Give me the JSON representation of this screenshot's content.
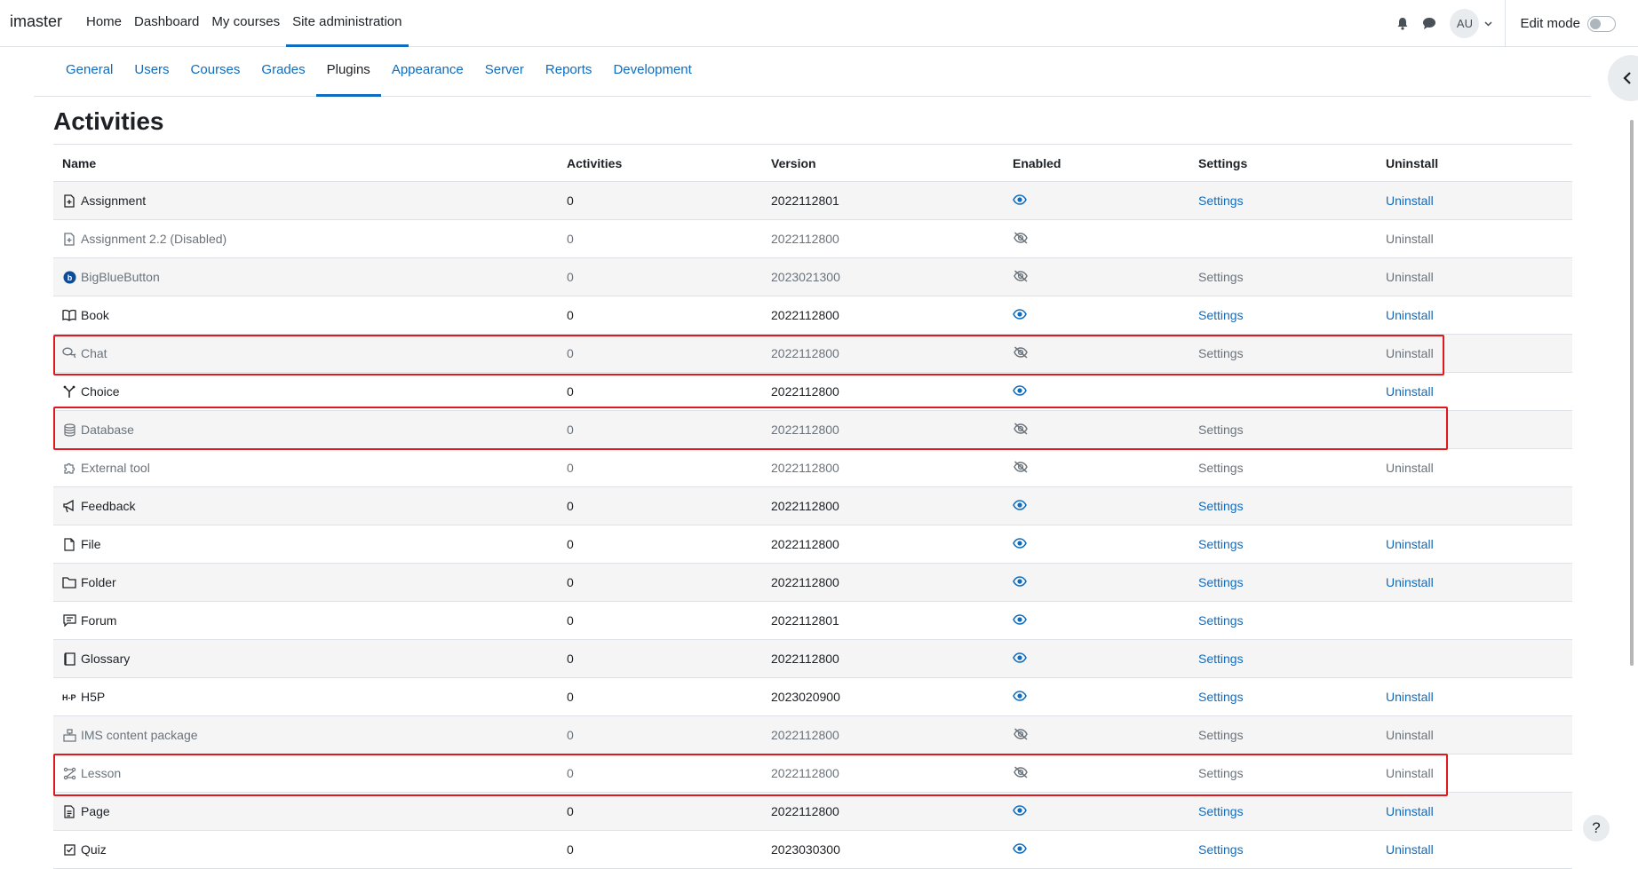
{
  "brand": "imaster",
  "primary_nav": [
    {
      "label": "Home"
    },
    {
      "label": "Dashboard"
    },
    {
      "label": "My courses"
    },
    {
      "label": "Site administration",
      "active": true
    }
  ],
  "user": {
    "initials": "AU"
  },
  "edit_mode_label": "Edit mode",
  "secondary_tabs": [
    "General",
    "Users",
    "Courses",
    "Grades",
    "Plugins",
    "Appearance",
    "Server",
    "Reports",
    "Development"
  ],
  "active_tab": "Plugins",
  "page_title": "Activities",
  "columns": {
    "name": "Name",
    "activities": "Activities",
    "version": "Version",
    "enabled": "Enabled",
    "settings": "Settings",
    "uninstall": "Uninstall"
  },
  "rows": [
    {
      "name": "Assignment",
      "icon": "assignment-icon",
      "activities": "0",
      "version": "2022112801",
      "enabled": true,
      "settings": "Settings",
      "uninstall": "Uninstall"
    },
    {
      "name": "Assignment 2.2 (Disabled)",
      "icon": "assignment-icon",
      "activities": "0",
      "version": "2022112800",
      "enabled": false,
      "settings": "",
      "uninstall": "Uninstall"
    },
    {
      "name": "BigBlueButton",
      "icon": "bigbluebutton-icon",
      "activities": "0",
      "version": "2023021300",
      "enabled": false,
      "settings": "Settings",
      "uninstall": "Uninstall"
    },
    {
      "name": "Book",
      "icon": "book-icon",
      "activities": "0",
      "version": "2022112800",
      "enabled": true,
      "settings": "Settings",
      "uninstall": "Uninstall"
    },
    {
      "name": "Chat",
      "icon": "chat-icon",
      "activities": "0",
      "version": "2022112800",
      "enabled": false,
      "settings": "Settings",
      "uninstall": "Uninstall",
      "highlighted": true
    },
    {
      "name": "Choice",
      "icon": "choice-icon",
      "activities": "0",
      "version": "2022112800",
      "enabled": true,
      "settings": "",
      "uninstall": "Uninstall"
    },
    {
      "name": "Database",
      "icon": "database-icon",
      "activities": "0",
      "version": "2022112800",
      "enabled": false,
      "settings": "Settings",
      "uninstall": "",
      "highlighted": true
    },
    {
      "name": "External tool",
      "icon": "puzzle-icon",
      "activities": "0",
      "version": "2022112800",
      "enabled": false,
      "settings": "Settings",
      "uninstall": "Uninstall"
    },
    {
      "name": "Feedback",
      "icon": "megaphone-icon",
      "activities": "0",
      "version": "2022112800",
      "enabled": true,
      "settings": "Settings",
      "uninstall": ""
    },
    {
      "name": "File",
      "icon": "file-icon",
      "activities": "0",
      "version": "2022112800",
      "enabled": true,
      "settings": "Settings",
      "uninstall": "Uninstall"
    },
    {
      "name": "Folder",
      "icon": "folder-icon",
      "activities": "0",
      "version": "2022112800",
      "enabled": true,
      "settings": "Settings",
      "uninstall": "Uninstall"
    },
    {
      "name": "Forum",
      "icon": "forum-icon",
      "activities": "0",
      "version": "2022112801",
      "enabled": true,
      "settings": "Settings",
      "uninstall": ""
    },
    {
      "name": "Glossary",
      "icon": "glossary-icon",
      "activities": "0",
      "version": "2022112800",
      "enabled": true,
      "settings": "Settings",
      "uninstall": ""
    },
    {
      "name": "H5P",
      "icon": "h5p-icon",
      "activities": "0",
      "version": "2023020900",
      "enabled": true,
      "settings": "Settings",
      "uninstall": "Uninstall"
    },
    {
      "name": "IMS content package",
      "icon": "package-icon",
      "activities": "0",
      "version": "2022112800",
      "enabled": false,
      "settings": "Settings",
      "uninstall": "Uninstall"
    },
    {
      "name": "Lesson",
      "icon": "lesson-icon",
      "activities": "0",
      "version": "2022112800",
      "enabled": false,
      "settings": "Settings",
      "uninstall": "Uninstall",
      "highlighted": true
    },
    {
      "name": "Page",
      "icon": "page-icon",
      "activities": "0",
      "version": "2022112800",
      "enabled": true,
      "settings": "Settings",
      "uninstall": "Uninstall"
    },
    {
      "name": "Quiz",
      "icon": "quiz-icon",
      "activities": "0",
      "version": "2023030300",
      "enabled": true,
      "settings": "Settings",
      "uninstall": "Uninstall"
    }
  ],
  "help_label": "?",
  "colors": {
    "link": "#0f6cbf",
    "disabled_text": "#6a737b",
    "highlight": "#e0191c",
    "stripe": "#f5f5f5"
  }
}
